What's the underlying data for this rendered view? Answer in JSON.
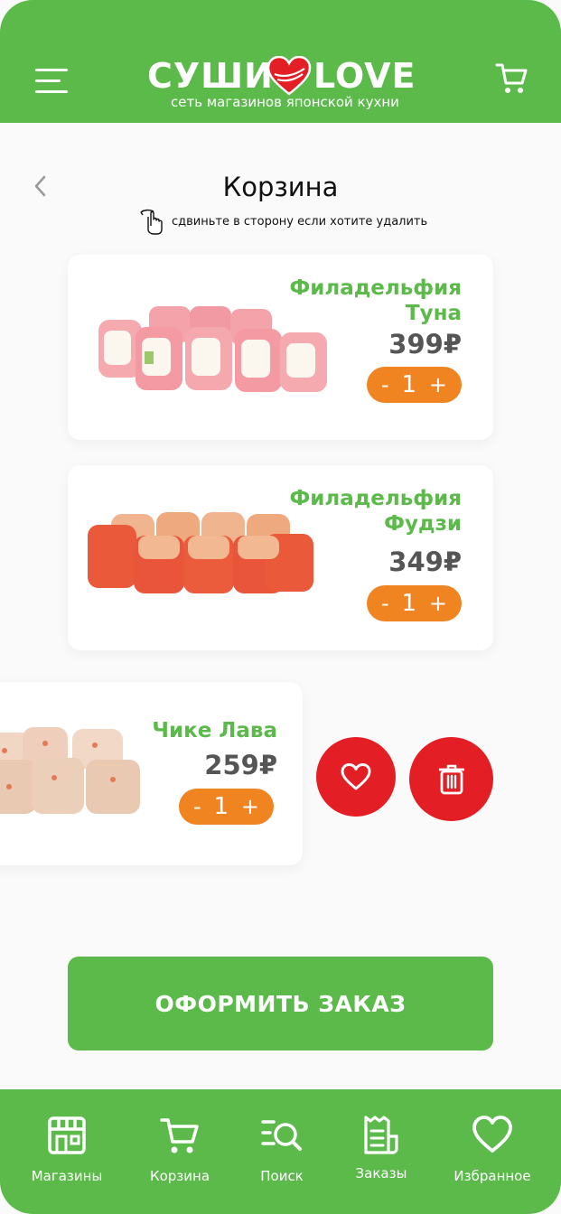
{
  "header": {
    "logo_left": "СУШИ",
    "logo_right": "LOVE",
    "logo_subtitle": "сеть магазинов японской кухни",
    "menu_icon": "hamburger-menu-icon",
    "cart_icon": "cart-icon"
  },
  "page": {
    "title": "Корзина",
    "hint": "сдвиньте в сторону если хотите удалить"
  },
  "cart_items": [
    {
      "name_line1": "Филадельфия",
      "name_line2": "Туна",
      "price": "399₽",
      "qty": "1",
      "minus": "-",
      "plus": "+"
    },
    {
      "name_line1": "Филадельфия",
      "name_line2": "Фудзи",
      "price": "349₽",
      "qty": "1",
      "minus": "-",
      "plus": "+"
    },
    {
      "name_line1": "Чике Лава",
      "price": "259₽",
      "qty": "1",
      "minus": "-",
      "plus": "+"
    }
  ],
  "swipe_actions": {
    "favorite_icon": "heart-icon",
    "delete_icon": "trash-icon"
  },
  "order_button": "ОФОРМИТЬ ЗАКАЗ",
  "bottom_nav": [
    {
      "label": "Магазины",
      "icon": "store-icon"
    },
    {
      "label": "Корзина",
      "icon": "cart-icon"
    },
    {
      "label": "Поиск",
      "icon": "search-icon"
    },
    {
      "label": "Заказы",
      "icon": "receipt-icon"
    },
    {
      "label": "Избранное",
      "icon": "heart-icon"
    }
  ],
  "colors": {
    "green": "#5bba4a",
    "orange": "#f08421",
    "red": "#e31e24",
    "price_gray": "#555555"
  }
}
